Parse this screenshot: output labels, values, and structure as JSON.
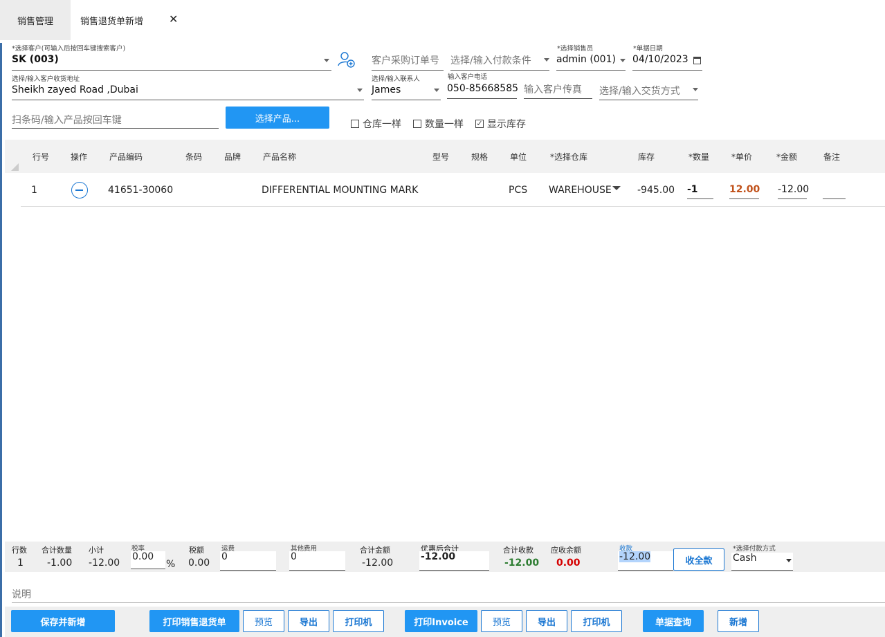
{
  "tabs": [
    {
      "label": "销售管理"
    },
    {
      "label": "销售退货单新增"
    }
  ],
  "tab_close": "✕",
  "form": {
    "customer": {
      "label": "*选择客户(可输入后按回车键搜索客户)",
      "value": "SK (003)"
    },
    "customer_po": {
      "placeholder": "客户采购订单号"
    },
    "payment_terms": {
      "placeholder": "选择/输入付款条件"
    },
    "salesperson": {
      "label": "*选择销售员",
      "value": "admin (001)"
    },
    "date": {
      "label": "*单据日期",
      "value": "04/10/2023"
    },
    "address": {
      "label": "选择/输入客户收货地址",
      "value": "Sheikh zayed Road ,Dubai"
    },
    "contact": {
      "label": "选择/输入联系人",
      "value": "James"
    },
    "phone": {
      "label": "输入客户电话",
      "value": "050-85668585"
    },
    "fax": {
      "placeholder": "输入客户传真"
    },
    "delivery": {
      "placeholder": "选择/输入交货方式"
    },
    "scan": {
      "placeholder": "扫条码/输入产品按回车键"
    },
    "select_product_button": "选择产品...",
    "checks": [
      {
        "label": "仓库一样",
        "checked": false
      },
      {
        "label": "数量一样",
        "checked": false
      },
      {
        "label": "显示库存",
        "checked": true
      }
    ]
  },
  "table": {
    "headers": [
      "行号",
      "操作",
      "产品编码",
      "条码",
      "品牌",
      "产品名称",
      "型号",
      "规格",
      "单位",
      "*选择仓库",
      "库存",
      "*数量",
      "*单价",
      "*金额",
      "备注"
    ],
    "rows": [
      {
        "no": "1",
        "code": "41651-30060",
        "barcode": "",
        "brand": "",
        "name": "DIFFERENTIAL MOUNTING MARK",
        "model": "",
        "spec": "",
        "unit": "PCS",
        "warehouse": "WAREHOUSE",
        "stock": "-945.00",
        "qty": "-1",
        "price": "12.00",
        "amount": "-12.00",
        "remark": ""
      }
    ]
  },
  "footer": {
    "rows_label": "行数",
    "rows_value": "1",
    "total_qty_label": "合计数量",
    "total_qty_value": "-1.00",
    "subtotal_label": "小计",
    "subtotal_value": "-12.00",
    "tax_rate_label": "税率",
    "tax_rate_value": "0.00",
    "percent": "%",
    "tax_label": "税额",
    "tax_value": "0.00",
    "shipping_label": "运费",
    "shipping_value": "0",
    "other_label": "其他费用",
    "other_value": "0",
    "total_label": "合计金额",
    "total_value": "-12.00",
    "discounted_label": "优惠后合计",
    "discounted_value": "-12.00",
    "received_total_label": "合计收款",
    "received_total_value": "-12.00",
    "balance_label": "应收余额",
    "balance_value": "0.00",
    "receive_label": "收款",
    "receive_value": "-12.00",
    "receive_all_button": "收全款",
    "pay_method_label": "*选择付款方式",
    "pay_method_value": "Cash"
  },
  "note_placeholder": "说明",
  "actions": {
    "save_new": "保存并新增",
    "print_return": "打印销售退货单",
    "preview1": "预览",
    "export1": "导出",
    "printer1": "打印机",
    "print_invoice": "打印Invoice",
    "preview2": "预览",
    "export2": "导出",
    "printer2": "打印机",
    "query": "单据查询",
    "new": "新增"
  },
  "colors": {
    "accent": "#2196f3",
    "positive": "#2e7d32",
    "negative": "#d50000",
    "price": "#c1521b"
  }
}
